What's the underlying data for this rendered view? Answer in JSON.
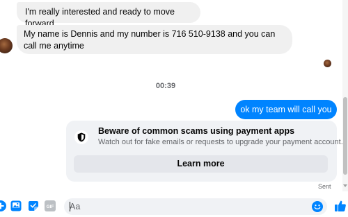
{
  "messages": [
    {
      "text": "I'm really interested and ready to move forward"
    },
    {
      "text": "My name is Dennis and my number is 716 510-9138 and you can call me anytime"
    }
  ],
  "timestamp": "00:39",
  "outgoing": {
    "text": "ok my team will call you"
  },
  "safety_notice": {
    "title": "Beware of common scams using payment apps",
    "subtitle": "Watch out for fake emails or requests to upgrade your payment account.",
    "button_label": "Learn more",
    "icon": "shield-icon"
  },
  "status": "Sent",
  "composer": {
    "placeholder": "Aa",
    "value": "",
    "tools": [
      {
        "icon": "plus-circle-icon"
      },
      {
        "icon": "photo-icon"
      },
      {
        "icon": "sticker-icon"
      },
      {
        "icon": "gif-icon",
        "label": "GIF"
      }
    ],
    "emoji_icon": "emoji-icon",
    "like_icon": "thumbs-up-icon"
  },
  "colors": {
    "accent": "#0084ff",
    "incoming_bubble": "#f0f0f0",
    "card_bg": "#f0f2f5",
    "button_bg": "#e4e6eb",
    "muted_text": "#65676b"
  }
}
